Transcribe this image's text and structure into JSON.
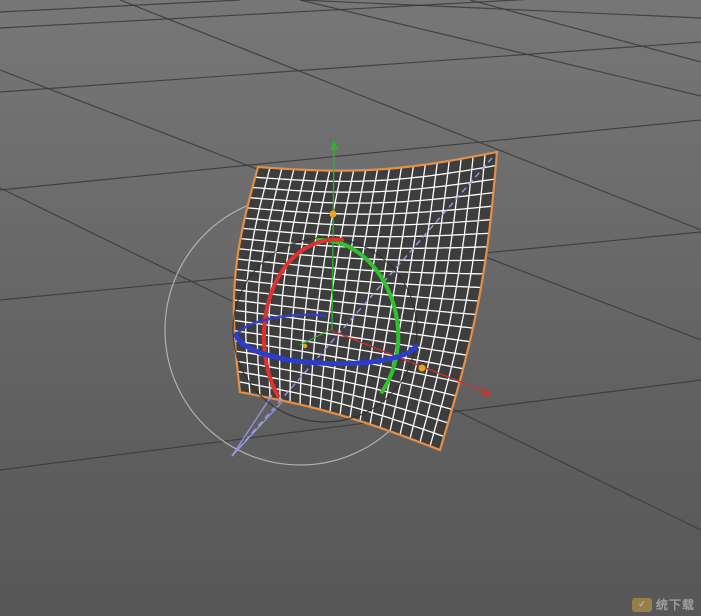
{
  "viewport": {
    "background_top": "#777777",
    "background_bottom": "#575757",
    "floor_grid_color": "#3a3a3a"
  },
  "object": {
    "type": "bent-plane-mesh",
    "mesh_color": "#ffffff",
    "mesh_fill": "#3d3d3d",
    "selection_outline_color": "#e0904a",
    "segments_u": 20,
    "segments_v": 22
  },
  "rotation_gizmo": {
    "x_ring_color": "#e03030",
    "y_ring_color": "#30c030",
    "z_ring_color": "#2d3cd0",
    "view_ring_color": "#b8b8b8",
    "handle_color": "#f0a020"
  },
  "axes": {
    "x_color": "#cc3030",
    "y_color": "#30b030",
    "z_color": "#9a9ae6"
  },
  "watermark": {
    "badge": "✓",
    "text": "统下载"
  }
}
